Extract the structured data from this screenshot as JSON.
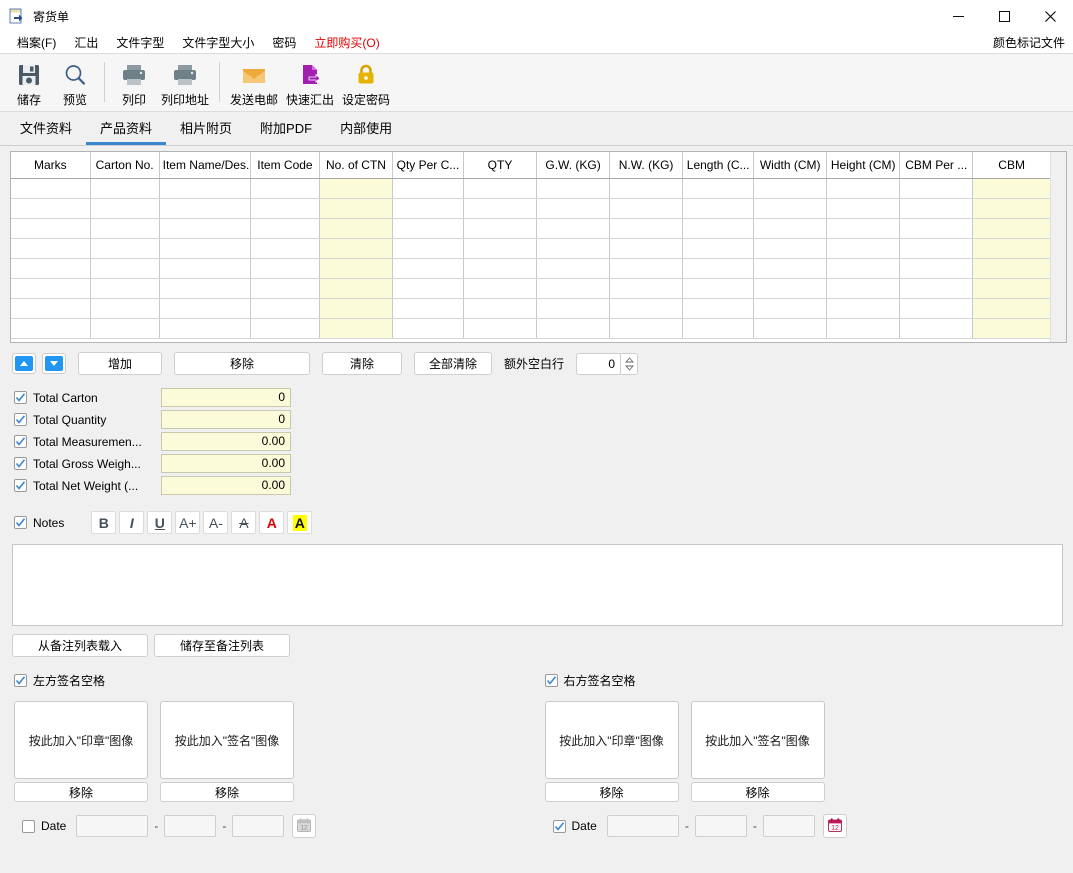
{
  "window": {
    "title": "寄货单",
    "icon": "export-document-icon",
    "minimize": "–",
    "maximize": "□",
    "close": "✕"
  },
  "menubar": {
    "items": [
      {
        "label": "档案(F)",
        "accel": "F",
        "accent": false
      },
      {
        "label": "汇出",
        "accel": "",
        "accent": false
      },
      {
        "label": "文件字型",
        "accel": "",
        "accent": false
      },
      {
        "label": "文件字型大小",
        "accel": "",
        "accent": false
      },
      {
        "label": "密码",
        "accel": "",
        "accent": false
      },
      {
        "label": "立即购买(O)",
        "accel": "O",
        "accent": true
      }
    ],
    "right_label": "颜色标记文件"
  },
  "toolbar": {
    "buttons": [
      {
        "label": "储存",
        "icon": "save-floppy-icon"
      },
      {
        "label": "预览",
        "icon": "magnifier-preview-icon"
      },
      {
        "label": "列印",
        "icon": "printer-icon"
      },
      {
        "label": "列印地址",
        "icon": "printer-address-icon"
      },
      {
        "label": "发送电邮",
        "icon": "envelope-mail-icon"
      },
      {
        "label": "快速汇出",
        "icon": "export-arrow-icon"
      },
      {
        "label": "设定密码",
        "icon": "lock-padlock-icon"
      }
    ]
  },
  "tabs": [
    {
      "label": "文件资料",
      "active": false
    },
    {
      "label": "产品资料",
      "active": true
    },
    {
      "label": "相片附页",
      "active": false
    },
    {
      "label": "附加PDF",
      "active": false
    },
    {
      "label": "内部使用",
      "active": false
    }
  ],
  "table": {
    "columns": [
      {
        "label": "Marks",
        "highlight": false
      },
      {
        "label": "Carton No.",
        "highlight": false
      },
      {
        "label": "Item Name/Des...",
        "highlight": false
      },
      {
        "label": "Item Code",
        "highlight": false
      },
      {
        "label": "No. of CTN",
        "highlight": true
      },
      {
        "label": "Qty Per C...",
        "highlight": false
      },
      {
        "label": "QTY",
        "highlight": false
      },
      {
        "label": "G.W. (KG)",
        "highlight": false
      },
      {
        "label": "N.W. (KG)",
        "highlight": false
      },
      {
        "label": "Length (C...",
        "highlight": false
      },
      {
        "label": "Width (CM)",
        "highlight": false
      },
      {
        "label": "Height (CM)",
        "highlight": false
      },
      {
        "label": "CBM Per ...",
        "highlight": false
      },
      {
        "label": "CBM",
        "highlight": true
      }
    ],
    "row_count": 8,
    "rows": [
      [
        "",
        "",
        "",
        "",
        "",
        "",
        "",
        "",
        "",
        "",
        "",
        "",
        "",
        ""
      ],
      [
        "",
        "",
        "",
        "",
        "",
        "",
        "",
        "",
        "",
        "",
        "",
        "",
        "",
        ""
      ],
      [
        "",
        "",
        "",
        "",
        "",
        "",
        "",
        "",
        "",
        "",
        "",
        "",
        "",
        ""
      ],
      [
        "",
        "",
        "",
        "",
        "",
        "",
        "",
        "",
        "",
        "",
        "",
        "",
        "",
        ""
      ],
      [
        "",
        "",
        "",
        "",
        "",
        "",
        "",
        "",
        "",
        "",
        "",
        "",
        "",
        ""
      ],
      [
        "",
        "",
        "",
        "",
        "",
        "",
        "",
        "",
        "",
        "",
        "",
        "",
        "",
        ""
      ],
      [
        "",
        "",
        "",
        "",
        "",
        "",
        "",
        "",
        "",
        "",
        "",
        "",
        "",
        ""
      ],
      [
        "",
        "",
        "",
        "",
        "",
        "",
        "",
        "",
        "",
        "",
        "",
        "",
        "",
        ""
      ]
    ]
  },
  "row_controls": {
    "move_up": "▲",
    "move_down": "▼",
    "add": "增加",
    "remove": "移除",
    "clear": "清除",
    "clear_all": "全部清除",
    "extra_blank_label": "额外空白行",
    "extra_blank_value": "0"
  },
  "totals": [
    {
      "label": "Total Carton",
      "value": "0",
      "checked": true
    },
    {
      "label": "Total Quantity",
      "value": "0",
      "checked": true
    },
    {
      "label": "Total Measuremen...",
      "value": "0.00",
      "checked": true
    },
    {
      "label": "Total Gross Weigh...",
      "value": "0.00",
      "checked": true
    },
    {
      "label": "Total Net Weight (...",
      "value": "0.00",
      "checked": true
    }
  ],
  "notes": {
    "label": "Notes",
    "checked": true,
    "value": "",
    "format_buttons": [
      {
        "name": "bold-button",
        "glyph": "B",
        "style": "bold"
      },
      {
        "name": "italic-button",
        "glyph": "I",
        "style": "italic"
      },
      {
        "name": "underline-button",
        "glyph": "U",
        "style": "underline"
      },
      {
        "name": "increase-font-size-button",
        "glyph": "A+",
        "style": "plain"
      },
      {
        "name": "decrease-font-size-button",
        "glyph": "A-",
        "style": "plain"
      },
      {
        "name": "strikethrough-button",
        "glyph": "A",
        "style": "strike"
      },
      {
        "name": "font-color-button",
        "glyph": "A",
        "style": "red"
      },
      {
        "name": "highlight-color-button",
        "glyph": "A",
        "style": "highlight"
      }
    ],
    "load_button": "从备注列表载入",
    "save_button": "储存至备注列表"
  },
  "signature_left": {
    "checkbox_label": "左方签名空格",
    "checked": true,
    "stamp_placeholder": "按此加入\"印章\"图像",
    "sign_placeholder": "按此加入\"签名\"图像",
    "remove_label": "移除",
    "date": {
      "label": "Date",
      "checked": false,
      "year": "",
      "month": "",
      "day": "",
      "separator": "-",
      "calendar_icon": "calendar-icon-disabled"
    }
  },
  "signature_right": {
    "checkbox_label": "右方签名空格",
    "checked": true,
    "stamp_placeholder": "按此加入\"印章\"图像",
    "sign_placeholder": "按此加入\"签名\"图像",
    "remove_label": "移除",
    "date": {
      "label": "Date",
      "checked": true,
      "year": "",
      "month": "",
      "day": "",
      "separator": "-",
      "calendar_icon": "calendar-icon"
    }
  },
  "colors": {
    "accent_blue": "#3a87d0",
    "buy_now_red": "#e00000",
    "highlight_cell": "#fbfbd9",
    "window_bg": "#f0f0f0",
    "check_blue": "#3a87d0",
    "toolbar_purple": "#9c27b0",
    "toolbar_gold": "#d8a400",
    "toolbar_orange": "#f0b429"
  }
}
